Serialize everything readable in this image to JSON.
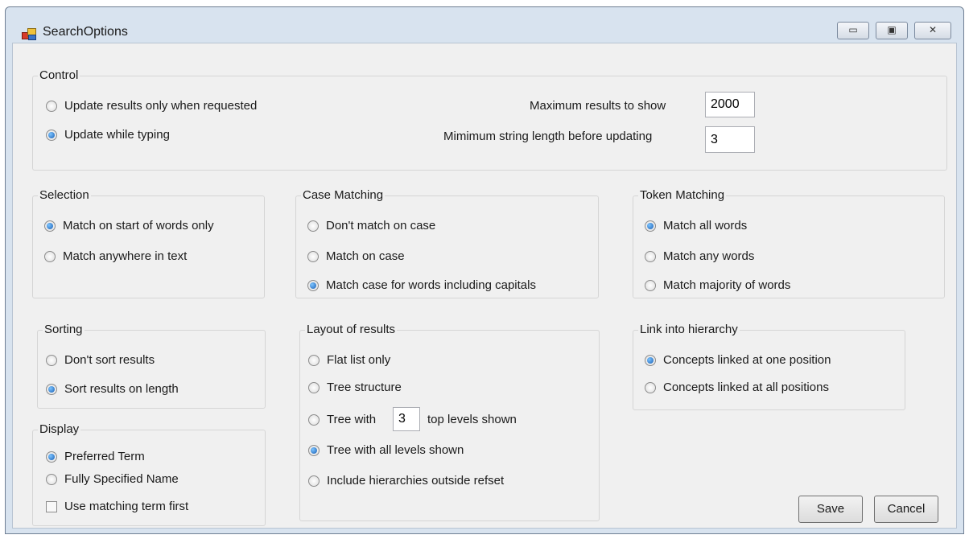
{
  "window": {
    "title": "SearchOptions"
  },
  "title_buttons": {
    "minimize": "▭",
    "maximize": "▣",
    "close": "✕"
  },
  "control": {
    "legend": "Control",
    "options": [
      "Update results only when requested",
      "Update while typing"
    ],
    "selected": 1,
    "max_results_label": "Maximum results to show",
    "max_results_value": "2000",
    "min_length_label": "Mimimum string length before updating",
    "min_length_value": "3"
  },
  "selection": {
    "legend": "Selection",
    "options": [
      "Match on start of words only",
      "Match anywhere in text"
    ],
    "selected": 0
  },
  "case_matching": {
    "legend": "Case Matching",
    "options": [
      "Don't match on case",
      "Match on case",
      "Match case for words including capitals"
    ],
    "selected": 2
  },
  "token_matching": {
    "legend": "Token Matching",
    "options": [
      "Match all words",
      "Match any words",
      "Match majority of words"
    ],
    "selected": 0
  },
  "sorting": {
    "legend": "Sorting",
    "options": [
      "Don't sort results",
      "Sort results on length"
    ],
    "selected": 1
  },
  "layout": {
    "legend": "Layout of results",
    "flat": "Flat list only",
    "tree": "Tree structure",
    "tree_with": "Tree with",
    "tree_levels_value": "3",
    "top_levels": "top levels shown",
    "all_levels": "Tree with all levels shown",
    "include": "Include hierarchies outside refset",
    "selected": "all_levels"
  },
  "link": {
    "legend": "Link into hierarchy",
    "options": [
      "Concepts linked at one position",
      "Concepts linked at all positions"
    ],
    "selected": 0
  },
  "display": {
    "legend": "Display",
    "options": [
      "Preferred Term",
      "Fully Specified Name"
    ],
    "selected": 0,
    "checkbox_label": "Use matching term first",
    "checkbox_checked": false
  },
  "buttons": {
    "save": "Save",
    "cancel": "Cancel"
  }
}
